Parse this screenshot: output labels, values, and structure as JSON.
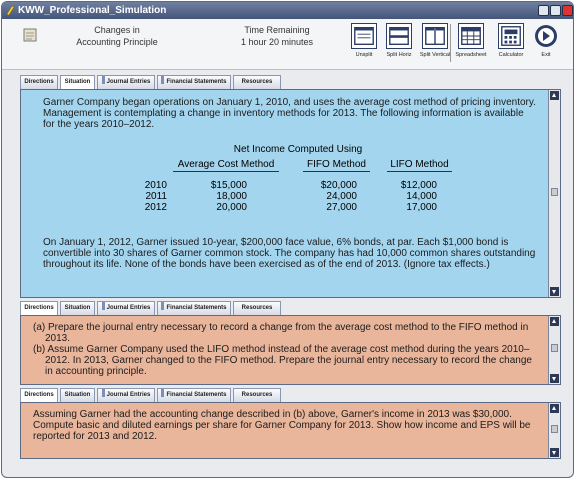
{
  "window": {
    "title": "KWW_Professional_Simulation"
  },
  "header": {
    "sim_name_line1": "Changes in",
    "sim_name_line2": "Accounting Principle",
    "time_label": "Time Remaining",
    "time_value": "1 hour 20 minutes",
    "tools": [
      "Unsplit",
      "Split Horiz",
      "Split Vertical",
      "Spreadsheet",
      "Calculator",
      "Exit"
    ]
  },
  "tabs": [
    "Directions",
    "Situation",
    "Journal Entries",
    "Financial Statements",
    "Resources"
  ],
  "situation": {
    "para1": "Garner Company began operations on January 1, 2010, and uses the average cost method of pricing inventory. Management is contemplating a change in inventory methods for 2013. The following information is available for the years 2010–2012.",
    "table_title": "Net Income Computed Using",
    "columns": [
      "Average Cost Method",
      "FIFO Method",
      "LIFO Method"
    ],
    "rows": [
      {
        "year": "2010",
        "avg": "$15,000",
        "fifo": "$20,000",
        "lifo": "$12,000"
      },
      {
        "year": "2011",
        "avg": "18,000",
        "fifo": "24,000",
        "lifo": "14,000"
      },
      {
        "year": "2012",
        "avg": "20,000",
        "fifo": "27,000",
        "lifo": "17,000"
      }
    ],
    "para2": "On January 1, 2012, Garner issued 10-year, $200,000 face value, 6% bonds, at par. Each $1,000 bond is convertible into 30 shares of Garner common stock. The company has had 10,000 common shares outstanding throughout its life. None of the bonds have been exercised as of the end of 2013. (Ignore tax effects.)"
  },
  "directions_a": {
    "a": "(a) Prepare the journal entry necessary to record a change from the average cost method to the FIFO method in 2013.",
    "b": "(b) Assume Garner Company used the LIFO method instead of the average cost method during the years 2010–2012. In 2013, Garner changed to the FIFO method. Prepare the journal entry necessary to record the change in accounting principle."
  },
  "directions_b": {
    "text": "Assuming Garner had the accounting change described in (b) above, Garner's income in 2013 was $30,000. Compute basic and diluted earnings per share for Garner Company for 2013. Show how income and EPS will be reported for 2013 and 2012."
  },
  "colors": {
    "situation_bg": "#a4d5ef",
    "directions_bg": "#e9b69c",
    "titlebar": "#4f6088"
  }
}
